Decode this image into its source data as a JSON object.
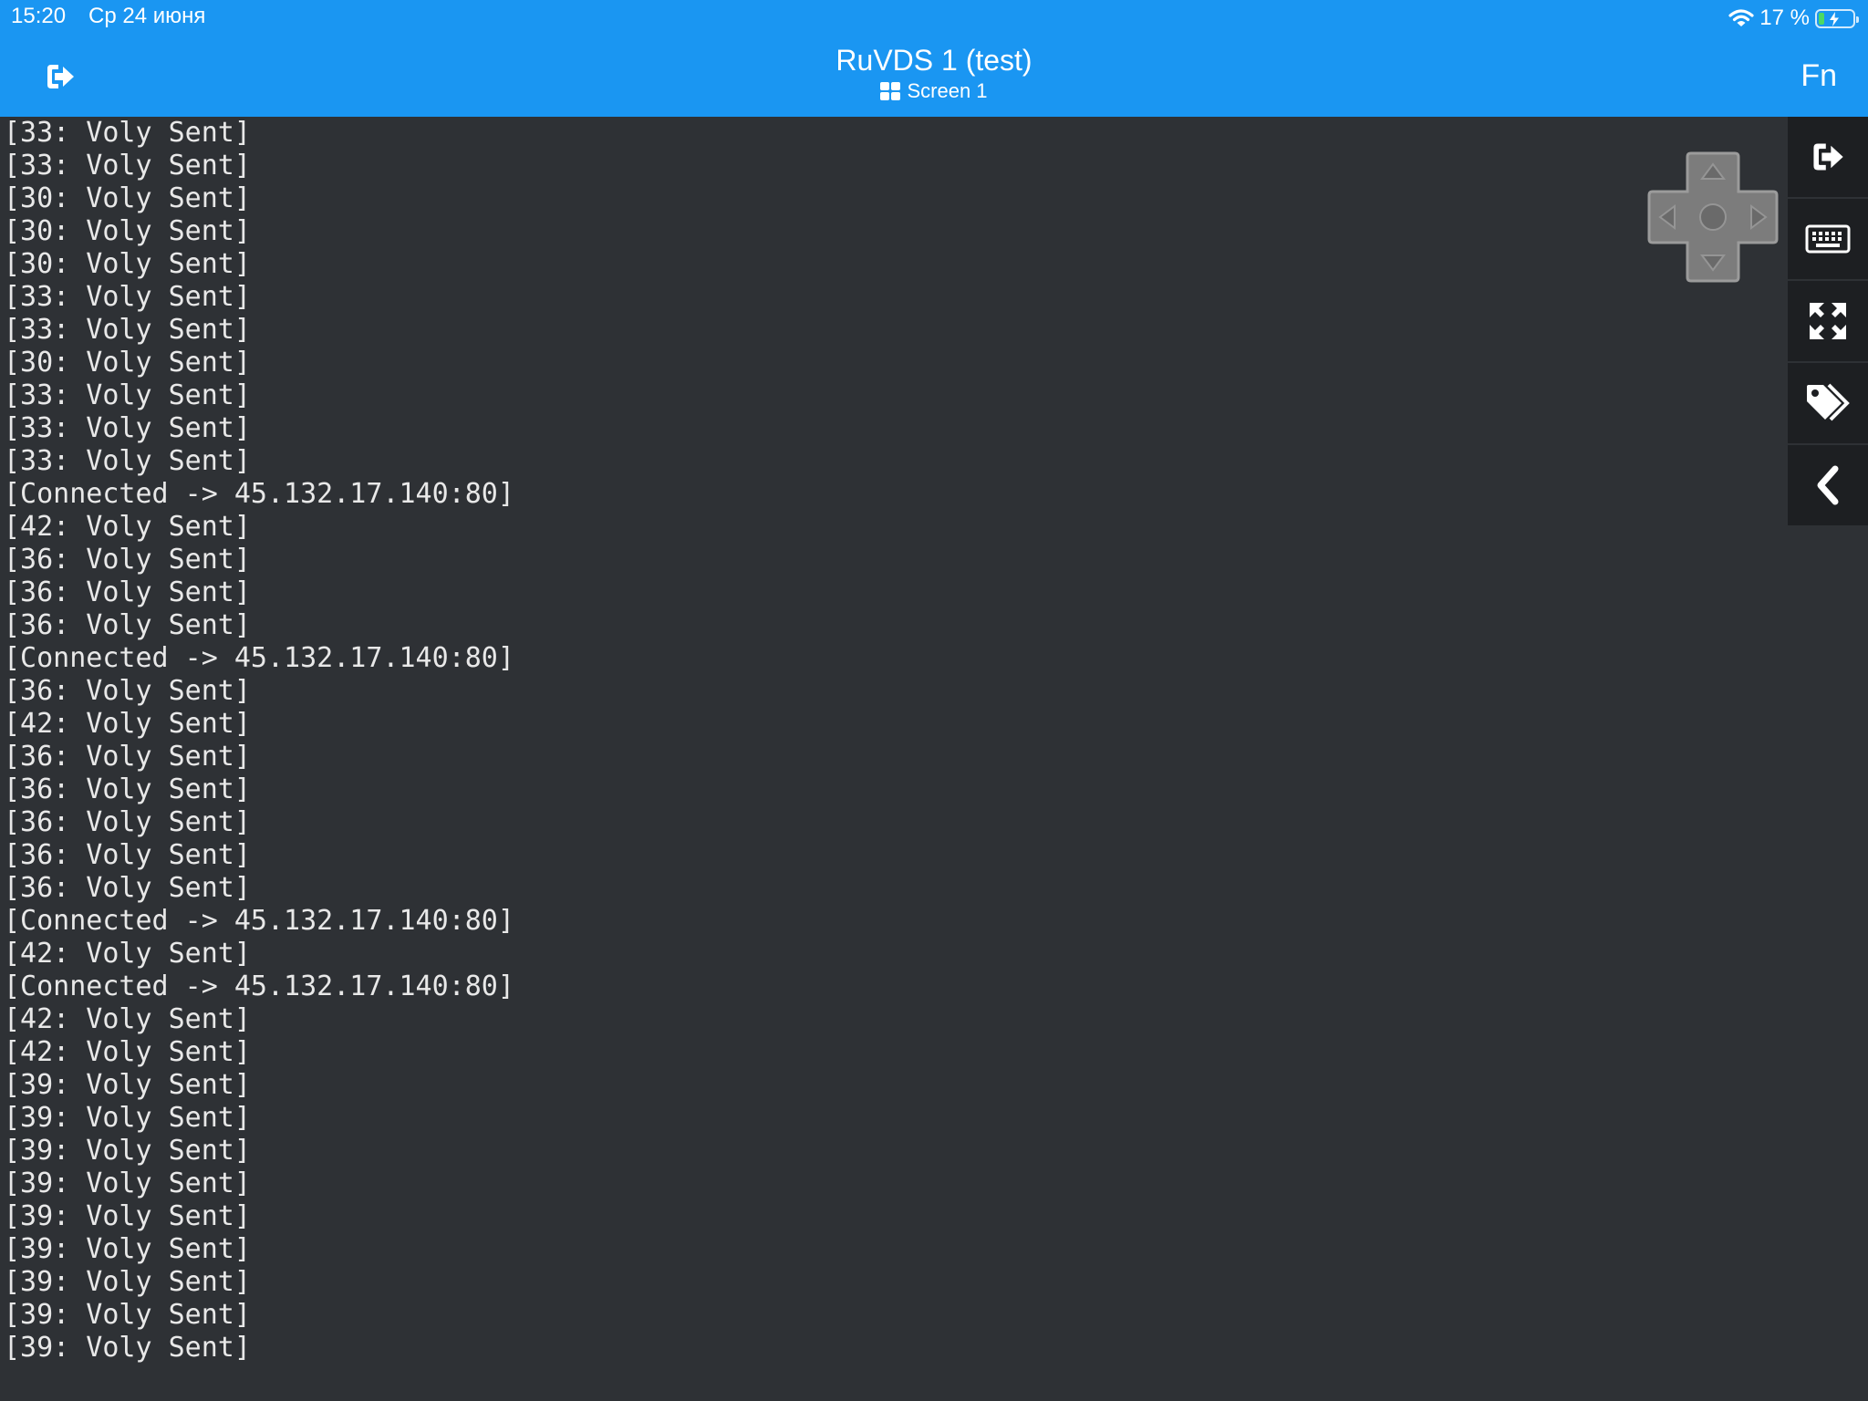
{
  "status_bar": {
    "time": "15:20",
    "date": "Ср 24 июня",
    "battery_text": "17 %",
    "battery_level": 0.17,
    "icons": [
      "wifi-icon",
      "battery-icon"
    ]
  },
  "header": {
    "title": "RuVDS 1 (test)",
    "subtitle": "Screen 1",
    "fn_label": "Fn",
    "left_icon": "disconnect-icon",
    "subtitle_icon": "grid-icon"
  },
  "terminal": {
    "lines": [
      "[33: Voly Sent]",
      "[33: Voly Sent]",
      "[30: Voly Sent]",
      "[30: Voly Sent]",
      "[30: Voly Sent]",
      "[33: Voly Sent]",
      "[33: Voly Sent]",
      "[30: Voly Sent]",
      "[33: Voly Sent]",
      "[33: Voly Sent]",
      "[33: Voly Sent]",
      "[Connected -> 45.132.17.140:80]",
      "[42: Voly Sent]",
      "[36: Voly Sent]",
      "[36: Voly Sent]",
      "[36: Voly Sent]",
      "[Connected -> 45.132.17.140:80]",
      "[36: Voly Sent]",
      "[42: Voly Sent]",
      "[36: Voly Sent]",
      "[36: Voly Sent]",
      "[36: Voly Sent]",
      "[36: Voly Sent]",
      "[36: Voly Sent]",
      "[Connected -> 45.132.17.140:80]",
      "[42: Voly Sent]",
      "[Connected -> 45.132.17.140:80]",
      "[42: Voly Sent]",
      "[42: Voly Sent]",
      "[39: Voly Sent]",
      "[39: Voly Sent]",
      "[39: Voly Sent]",
      "[39: Voly Sent]",
      "[39: Voly Sent]",
      "[39: Voly Sent]",
      "[39: Voly Sent]",
      "[39: Voly Sent]",
      "[39: Voly Sent]"
    ]
  },
  "sidebar": {
    "buttons": [
      "disconnect-icon",
      "keyboard-icon",
      "fullscreen-icon",
      "tags-icon",
      "collapse-icon"
    ]
  },
  "dpad": {
    "icons": [
      "up-arrow-icon",
      "down-arrow-icon",
      "left-arrow-icon",
      "right-arrow-icon",
      "center-icon"
    ]
  },
  "colors": {
    "header": "#1a96f2",
    "terminal_bg": "#2e3135",
    "terminal_text": "#e8e8e8",
    "sidebar_bg": "#1d1f22",
    "battery_fill": "#4cd964"
  }
}
